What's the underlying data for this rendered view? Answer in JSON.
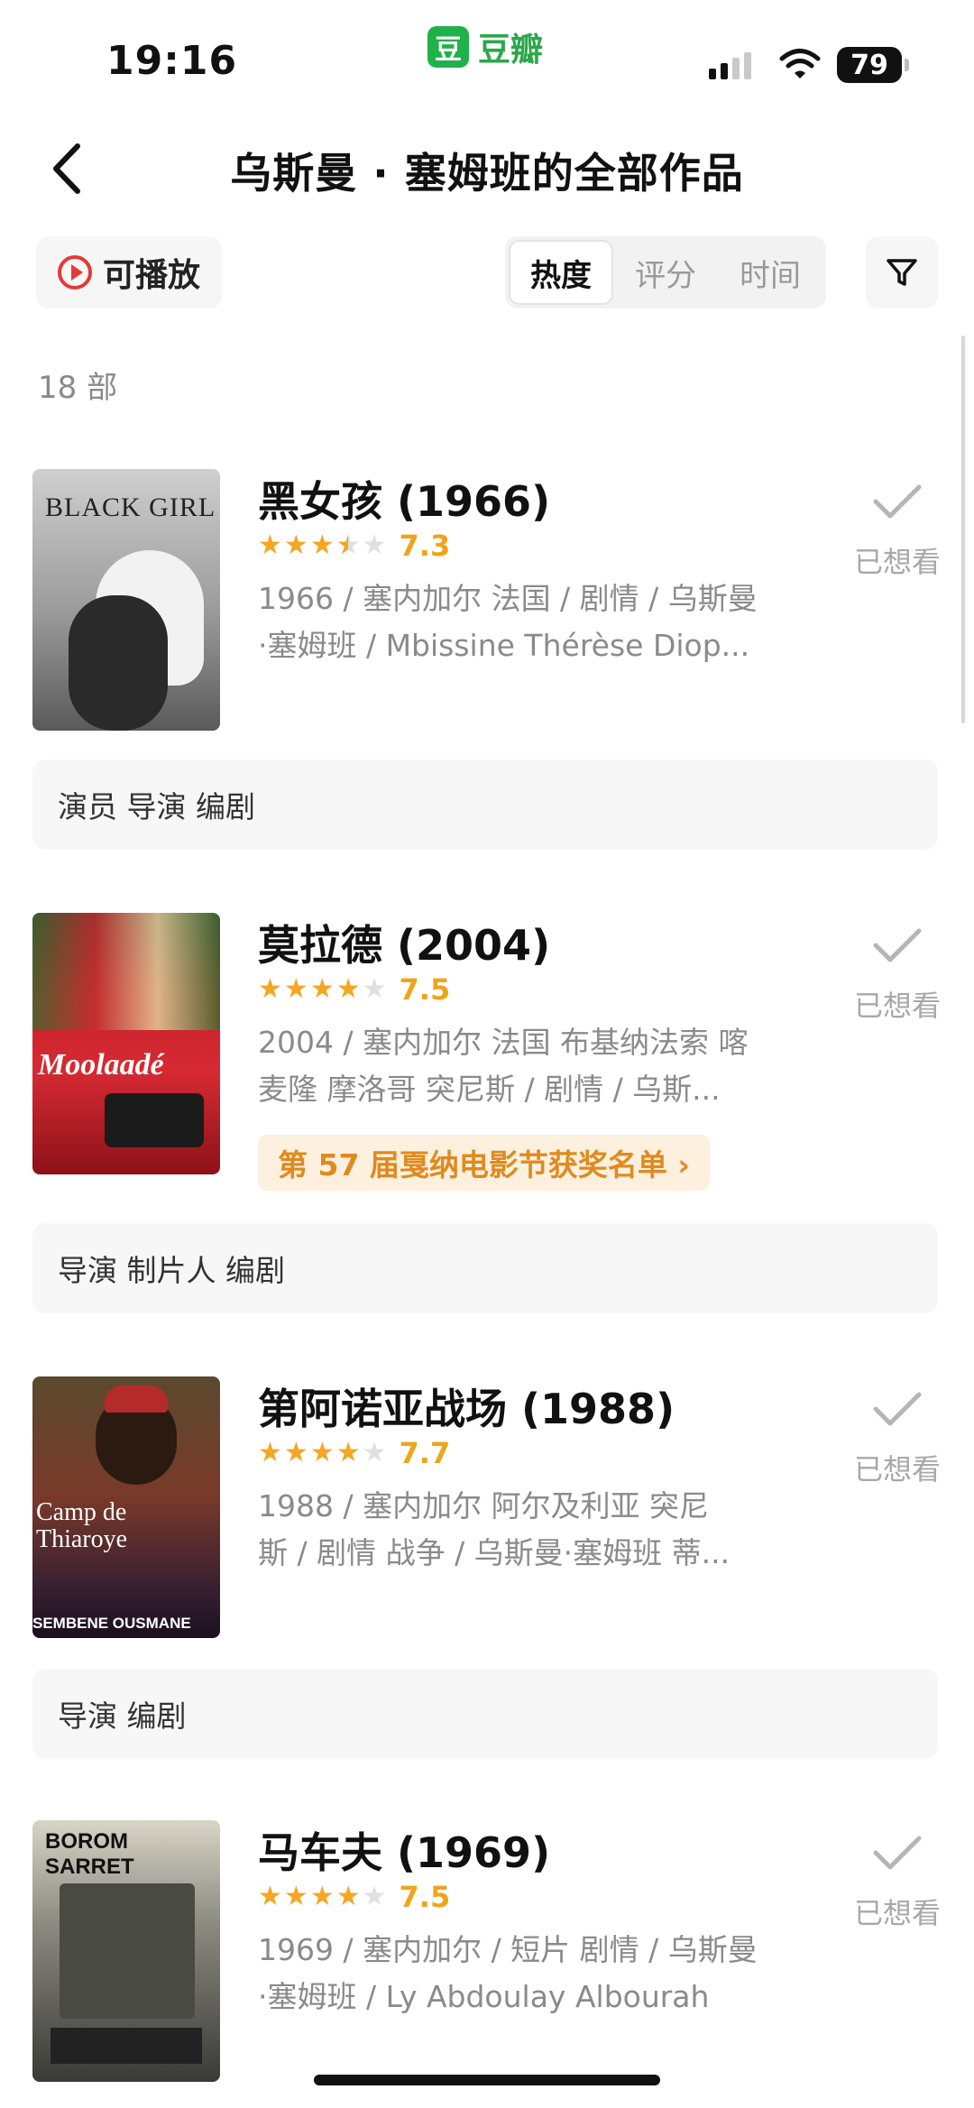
{
  "status": {
    "time": "19:16",
    "app_name": "豆瓣",
    "app_glyph": "豆",
    "battery": "79"
  },
  "header": {
    "title": "乌斯曼 · 塞姆班的全部作品"
  },
  "filters": {
    "playable_label": "可播放",
    "sort_options": [
      "热度",
      "评分",
      "时间"
    ],
    "active_sort": "热度"
  },
  "count_label": "18 部",
  "want_label": "已想看",
  "movies": [
    {
      "title": "黑女孩 (1966)",
      "stars": 3.5,
      "score": "7.3",
      "meta_line1": "1966 / 塞内加尔 法国 / 剧情 / 乌斯曼",
      "meta_line2": "·塞姆班 / Mbissine Thérèse Diop...",
      "poster_text": "BLACK GIRL",
      "roles": "演员 导演 编剧"
    },
    {
      "title": "莫拉德 (2004)",
      "stars": 4,
      "score": "7.5",
      "meta_line1": "2004 / 塞内加尔 法国 布基纳法索 喀",
      "meta_line2": "麦隆 摩洛哥 突尼斯 / 剧情 / 乌斯...",
      "award": "第 57 届戛纳电影节获奖名单 ›",
      "poster_text": "Moolaadé",
      "roles": "导演 制片人 编剧"
    },
    {
      "title": "第阿诺亚战场 (1988)",
      "stars": 4,
      "score": "7.7",
      "meta_line1": "1988 / 塞内加尔 阿尔及利亚 突尼",
      "meta_line2": "斯 / 剧情 战争 / 乌斯曼·塞姆班 蒂...",
      "poster_text": "Camp de Thiaroye",
      "poster_subtext": "SEMBENE OUSMANE",
      "roles": "导演 编剧"
    },
    {
      "title": "马车夫 (1969)",
      "stars": 4,
      "score": "7.5",
      "meta_line1": "1969 / 塞内加尔 / 短片 剧情 / 乌斯曼",
      "meta_line2": "·塞姆班 / Ly Abdoulay Albourah",
      "poster_text": "BOROM SARRET"
    }
  ]
}
